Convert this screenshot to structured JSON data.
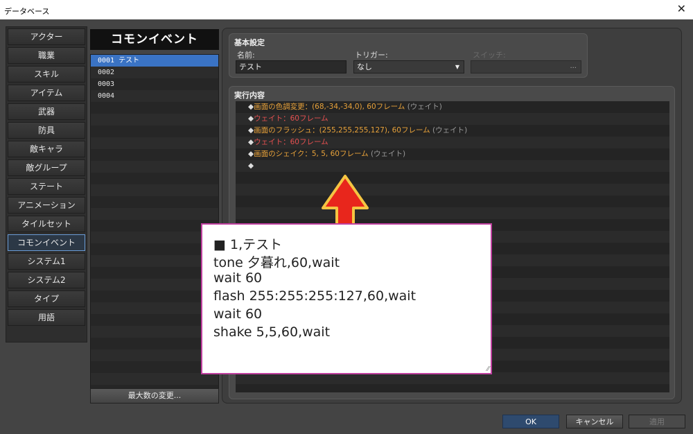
{
  "window": {
    "title": "データベース"
  },
  "nav": {
    "items": [
      "アクター",
      "職業",
      "スキル",
      "アイテム",
      "武器",
      "防具",
      "敵キャラ",
      "敵グループ",
      "ステート",
      "アニメーション",
      "タイルセット",
      "コモンイベント",
      "システム1",
      "システム2",
      "タイプ",
      "用語"
    ],
    "active_index": 11
  },
  "list": {
    "header": "コモンイベント",
    "rows": [
      "0001 テスト",
      "0002",
      "0003",
      "0004"
    ],
    "selected_index": 0,
    "max_button": "最大数の変更..."
  },
  "basic": {
    "group_label": "基本設定",
    "name_label": "名前:",
    "name_value": "テスト",
    "trigger_label": "トリガー:",
    "trigger_value": "なし",
    "switch_label": "スイッチ:",
    "switch_button": "..."
  },
  "exec": {
    "group_label": "実行内容",
    "commands": [
      {
        "diamond": "◆",
        "text": "画面の色調変更：(68,-34,-34,0), 60フレーム",
        "wait": " (ウェイト)",
        "color": "orange"
      },
      {
        "diamond": "◆",
        "text": "ウェイト：60フレーム",
        "wait": "",
        "color": "red"
      },
      {
        "diamond": "◆",
        "text": "画面のフラッシュ：(255,255,255,127), 60フレーム",
        "wait": " (ウェイト)",
        "color": "orange"
      },
      {
        "diamond": "◆",
        "text": "ウェイト：60フレーム",
        "wait": "",
        "color": "red"
      },
      {
        "diamond": "◆",
        "text": "画面のシェイク：5, 5, 60フレーム",
        "wait": " (ウェイト)",
        "color": "orange"
      },
      {
        "diamond": "◆",
        "text": "",
        "wait": "",
        "color": "orange"
      }
    ]
  },
  "note": {
    "lines": [
      "■ 1,テスト",
      "tone 夕暮れ,60,wait",
      "wait 60",
      "flash 255:255:255:127,60,wait",
      "wait 60",
      "shake 5,5,60,wait"
    ],
    "grip": "⁄⁄"
  },
  "buttons": {
    "ok": "OK",
    "cancel": "キャンセル",
    "apply": "適用"
  },
  "icons": {
    "close": "close-icon",
    "arrow": "up-arrow-icon",
    "dropdown": "chevron-down-icon"
  },
  "colors": {
    "accent": "#3a73c4",
    "orange_text": "#e8a23a",
    "red_text": "#e65050",
    "arrow_fill": "#e8261c",
    "arrow_outline": "#f5c542",
    "note_border": "#c040a0"
  }
}
